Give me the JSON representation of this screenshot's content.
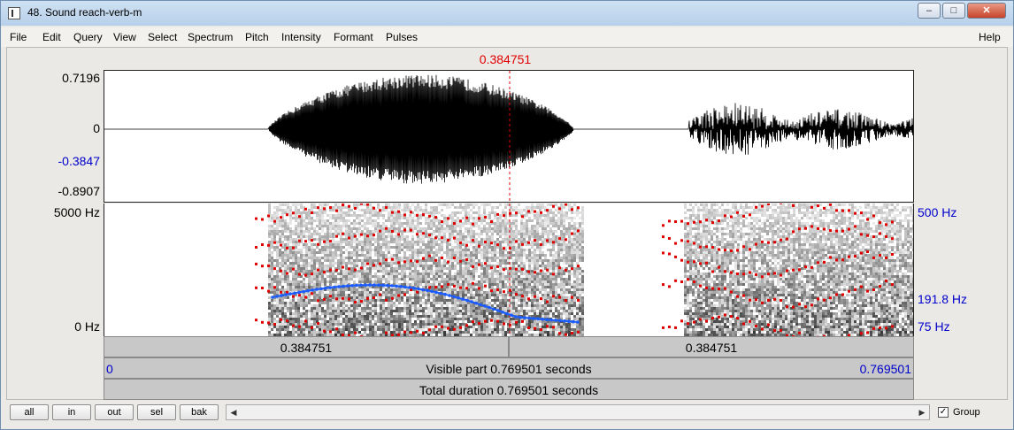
{
  "window": {
    "title": "48. Sound reach-verb-m",
    "minimize": "–",
    "maximize": "□",
    "close": "✕"
  },
  "menu": [
    "File",
    "Edit",
    "Query",
    "View",
    "Select",
    "Spectrum",
    "Pitch",
    "Intensity",
    "Formant",
    "Pulses"
  ],
  "help": "Help",
  "cursor_time": "0.384751",
  "waveform": {
    "label_max": "0.7196",
    "label_zero": "0",
    "label_cursor": "-0.3847",
    "label_min": "-0.8907"
  },
  "spectrogram": {
    "freq_top": "5000 Hz",
    "freq_bottom": "0 Hz",
    "pitch_top": "500 Hz",
    "pitch_cursor": "191.8 Hz",
    "pitch_bottom": "75 Hz"
  },
  "time_bar": {
    "left_segment": "0.384751",
    "right_segment": "0.384751"
  },
  "visible_bar": {
    "start": "0",
    "text": "Visible part 0.769501 seconds",
    "end": "0.769501"
  },
  "total_bar": {
    "text": "Total duration 0.769501 seconds"
  },
  "buttons": [
    "all",
    "in",
    "out",
    "sel",
    "bak"
  ],
  "group_label": "Group",
  "group_checked": true,
  "colors": {
    "cursor": "#e00000",
    "pitch": "#1a5cff",
    "formant": "#e00000",
    "axis_blue": "#0000cc"
  }
}
